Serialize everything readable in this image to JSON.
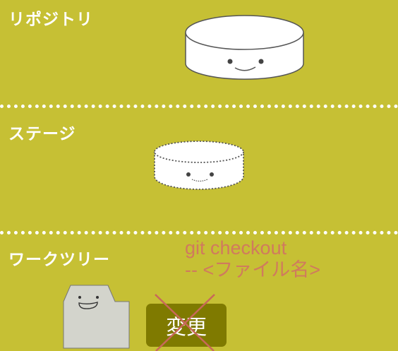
{
  "sections": {
    "repository": "リポジトリ",
    "stage": "ステージ",
    "worktree": "ワークツリー"
  },
  "command": {
    "line1": "git checkout",
    "line2": "-- <ファイル名>"
  },
  "change_button": "変更",
  "colors": {
    "background": "#c6c034",
    "command": "#d07a5e",
    "button": "#7f7a00",
    "cross": "#c8685a"
  }
}
